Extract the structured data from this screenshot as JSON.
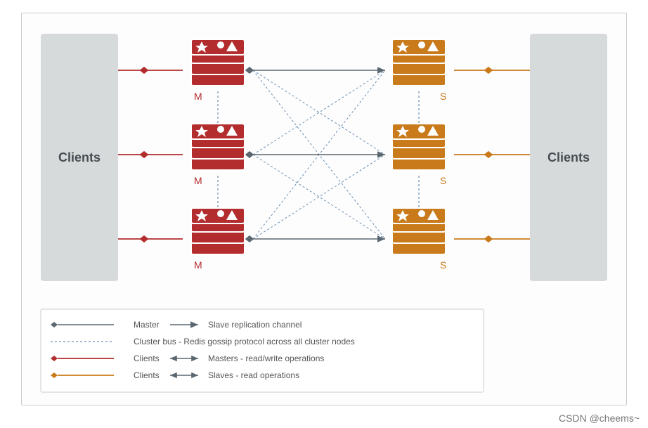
{
  "clients_label_left": "Clients",
  "clients_label_right": "Clients",
  "masters": [
    {
      "label": "M"
    },
    {
      "label": "M"
    },
    {
      "label": "M"
    }
  ],
  "slaves": [
    {
      "label": "S"
    },
    {
      "label": "S"
    },
    {
      "label": "S"
    }
  ],
  "legend": {
    "master_label": "Master",
    "slave_rep_label": "Slave replication channel",
    "cluster_bus_label": "Cluster bus - Redis gossip protocol across all cluster nodes",
    "clients_master_prefix": "Clients",
    "clients_master_label": "Masters - read/write operations",
    "clients_slave_prefix": "Clients",
    "clients_slave_label": "Slaves - read operations"
  },
  "colors": {
    "master": "#b32d2e",
    "slave": "#c97a1a",
    "panel": "#d7dadb",
    "line_dark": "#5b6770",
    "line_red": "#b32d2e",
    "line_orange": "#c97a1a",
    "dash_blue": "#6b8fb3"
  },
  "chart_data": {
    "type": "diagram",
    "title": "Redis Cluster topology",
    "nodes": [
      {
        "id": "clients_left",
        "type": "clients",
        "label": "Clients"
      },
      {
        "id": "clients_right",
        "type": "clients",
        "label": "Clients"
      },
      {
        "id": "M1",
        "type": "master",
        "label": "M"
      },
      {
        "id": "M2",
        "type": "master",
        "label": "M"
      },
      {
        "id": "M3",
        "type": "master",
        "label": "M"
      },
      {
        "id": "S1",
        "type": "slave",
        "label": "S"
      },
      {
        "id": "S2",
        "type": "slave",
        "label": "S"
      },
      {
        "id": "S3",
        "type": "slave",
        "label": "S"
      }
    ],
    "edges": [
      {
        "from": "clients_left",
        "to": "M1",
        "kind": "client-master"
      },
      {
        "from": "clients_left",
        "to": "M2",
        "kind": "client-master"
      },
      {
        "from": "clients_left",
        "to": "M3",
        "kind": "client-master"
      },
      {
        "from": "clients_right",
        "to": "S1",
        "kind": "client-slave"
      },
      {
        "from": "clients_right",
        "to": "S2",
        "kind": "client-slave"
      },
      {
        "from": "clients_right",
        "to": "S3",
        "kind": "client-slave"
      },
      {
        "from": "M1",
        "to": "S1",
        "kind": "replication"
      },
      {
        "from": "M2",
        "to": "S2",
        "kind": "replication"
      },
      {
        "from": "M3",
        "to": "S3",
        "kind": "replication"
      },
      {
        "from": "M1",
        "to": "S2",
        "kind": "cluster-bus"
      },
      {
        "from": "M1",
        "to": "S3",
        "kind": "cluster-bus"
      },
      {
        "from": "M2",
        "to": "S1",
        "kind": "cluster-bus"
      },
      {
        "from": "M2",
        "to": "S3",
        "kind": "cluster-bus"
      },
      {
        "from": "M3",
        "to": "S1",
        "kind": "cluster-bus"
      },
      {
        "from": "M3",
        "to": "S2",
        "kind": "cluster-bus"
      },
      {
        "from": "M1",
        "to": "M2",
        "kind": "cluster-bus"
      },
      {
        "from": "M2",
        "to": "M3",
        "kind": "cluster-bus"
      },
      {
        "from": "S1",
        "to": "S2",
        "kind": "cluster-bus"
      },
      {
        "from": "S2",
        "to": "S3",
        "kind": "cluster-bus"
      }
    ],
    "legend": [
      {
        "kind": "replication",
        "text": "Master → Slave replication channel"
      },
      {
        "kind": "cluster-bus",
        "text": "Cluster bus - Redis gossip protocol across all cluster nodes"
      },
      {
        "kind": "client-master",
        "text": "Clients ↔ Masters - read/write operations"
      },
      {
        "kind": "client-slave",
        "text": "Clients ↔ Slaves - read operations"
      }
    ]
  },
  "watermark": "CSDN @cheems~"
}
